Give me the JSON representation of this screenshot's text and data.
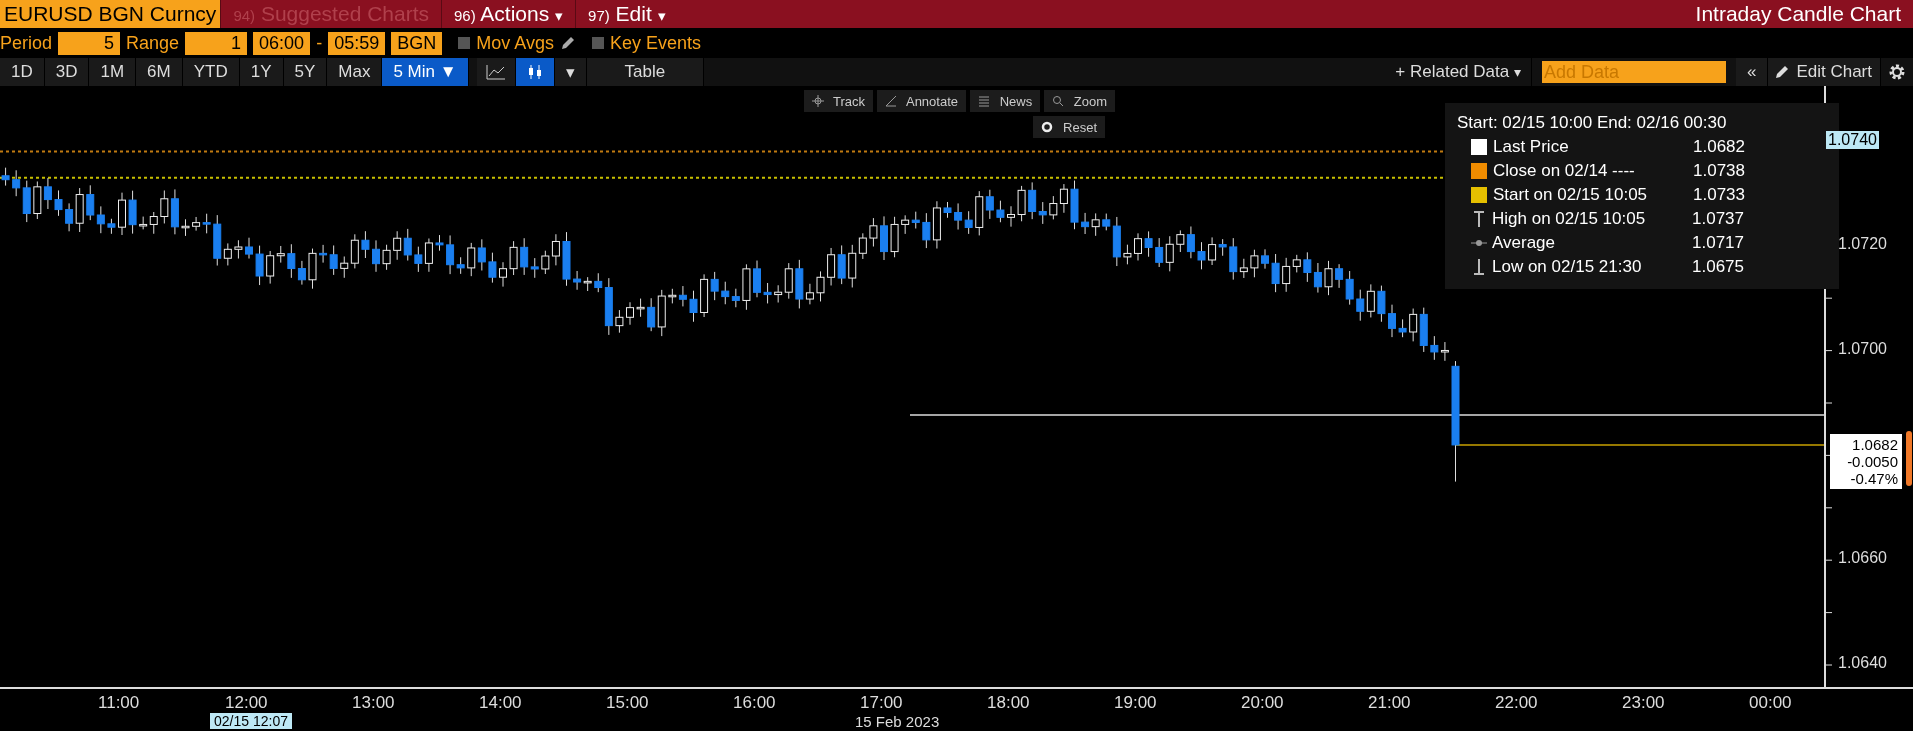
{
  "title_bar": {
    "security": "EURUSD BGN Curncy",
    "menus": [
      {
        "number": "94)",
        "label": "Suggested Charts",
        "disabled": true
      },
      {
        "number": "96)",
        "label": "Actions",
        "disabled": false,
        "caret": "▾"
      },
      {
        "number": "97)",
        "label": "Edit",
        "disabled": false,
        "caret": "▾"
      }
    ],
    "title": "Intraday Candle Chart"
  },
  "settings": {
    "period_label": "Period",
    "period": "5",
    "range_label": "Range",
    "range": "1",
    "start": "06:00",
    "separator": "-",
    "end": "05:59",
    "source": "BGN",
    "checkboxes": [
      {
        "label": "Mov Avgs",
        "checked": false,
        "editable": true
      },
      {
        "label": "Key Events",
        "checked": false,
        "editable": false
      }
    ]
  },
  "toolbar": {
    "ranges": [
      {
        "label": "1D",
        "selected": false
      },
      {
        "label": "3D",
        "selected": false
      },
      {
        "label": "1M",
        "selected": false
      },
      {
        "label": "6M",
        "selected": false
      },
      {
        "label": "YTD",
        "selected": false
      },
      {
        "label": "1Y",
        "selected": false
      },
      {
        "label": "5Y",
        "selected": false
      },
      {
        "label": "Max",
        "selected": false
      },
      {
        "label": "5 Min ▼",
        "selected": true
      }
    ],
    "chart_types": [
      {
        "kind": "line",
        "selected": false
      },
      {
        "kind": "candle",
        "selected": true
      }
    ],
    "dropdown": "▾",
    "table": "Table",
    "related_data": "+ Related Data",
    "related_caret": "▾",
    "add_data": {
      "placeholder": "Add Data"
    },
    "collapse": "«",
    "edit_chart": "Edit Chart"
  },
  "chart_tools": [
    {
      "kind": "track",
      "label": "Track"
    },
    {
      "kind": "annotate",
      "label": "Annotate"
    },
    {
      "kind": "news",
      "label": "News"
    },
    {
      "kind": "zoom",
      "label": "Zoom"
    },
    {
      "kind": "reset",
      "label": "Reset"
    }
  ],
  "legend": {
    "range": "Start: 02/15 10:00 End: 02/16 00:30",
    "items": [
      {
        "kind": "swatch",
        "color": "#ffffff",
        "label": "Last Price",
        "value": "1.0682"
      },
      {
        "kind": "swatch",
        "color": "#f08c00",
        "label": "Close on 02/14 ----",
        "value": "1.0738"
      },
      {
        "kind": "swatch",
        "color": "#e6c000",
        "label": "Start on 02/15 10:05",
        "value": "1.0733"
      },
      {
        "kind": "high",
        "label": "High on 02/15 10:05",
        "value": "1.0737"
      },
      {
        "kind": "average",
        "label": "Average",
        "value": "1.0717"
      },
      {
        "kind": "low",
        "label": "Low on 02/15 21:30",
        "value": "1.0675"
      }
    ]
  },
  "price_axis": {
    "crosshair": "1.0740",
    "labels": [
      "1.0720",
      "1.0700",
      "1.0660",
      "1.0640"
    ],
    "last": {
      "price": "1.0682",
      "change": "-0.0050",
      "percent": "-0.47%"
    }
  },
  "time_axis": {
    "labels": [
      "11:00",
      "12:00",
      "13:00",
      "14:00",
      "15:00",
      "16:00",
      "17:00",
      "18:00",
      "19:00",
      "20:00",
      "21:00",
      "22:00",
      "23:00",
      "00:00"
    ],
    "crosshair": "02/15 12:07",
    "date": "15 Feb 2023"
  }
}
